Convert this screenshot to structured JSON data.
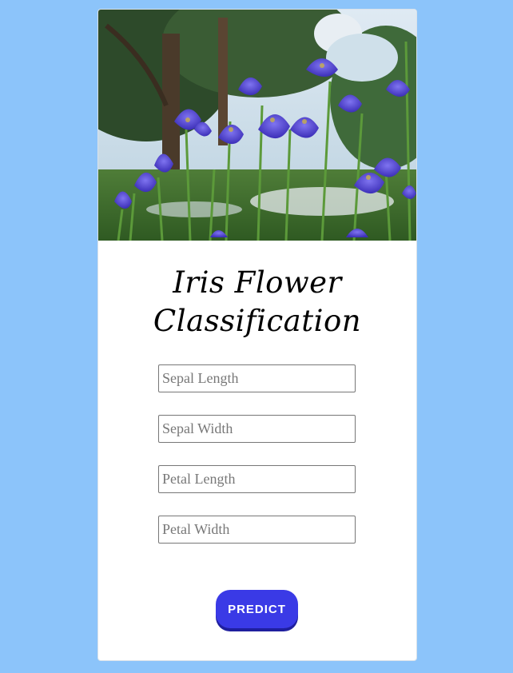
{
  "title": "Iris Flower Classification",
  "image": {
    "description": "photo of blue-violet iris flowers in a meadow"
  },
  "form": {
    "fields": [
      {
        "placeholder": "Sepal Length",
        "value": ""
      },
      {
        "placeholder": "Sepal Width",
        "value": ""
      },
      {
        "placeholder": "Petal Length",
        "value": ""
      },
      {
        "placeholder": "Petal Width",
        "value": ""
      }
    ],
    "submit_label": "PREDICT"
  },
  "colors": {
    "page_background": "#8cc4fa",
    "card_background": "#ffffff",
    "button_background": "#3a3ae6",
    "button_shadow": "#1f1f9e",
    "iris_petal": "#5a4fd6"
  }
}
